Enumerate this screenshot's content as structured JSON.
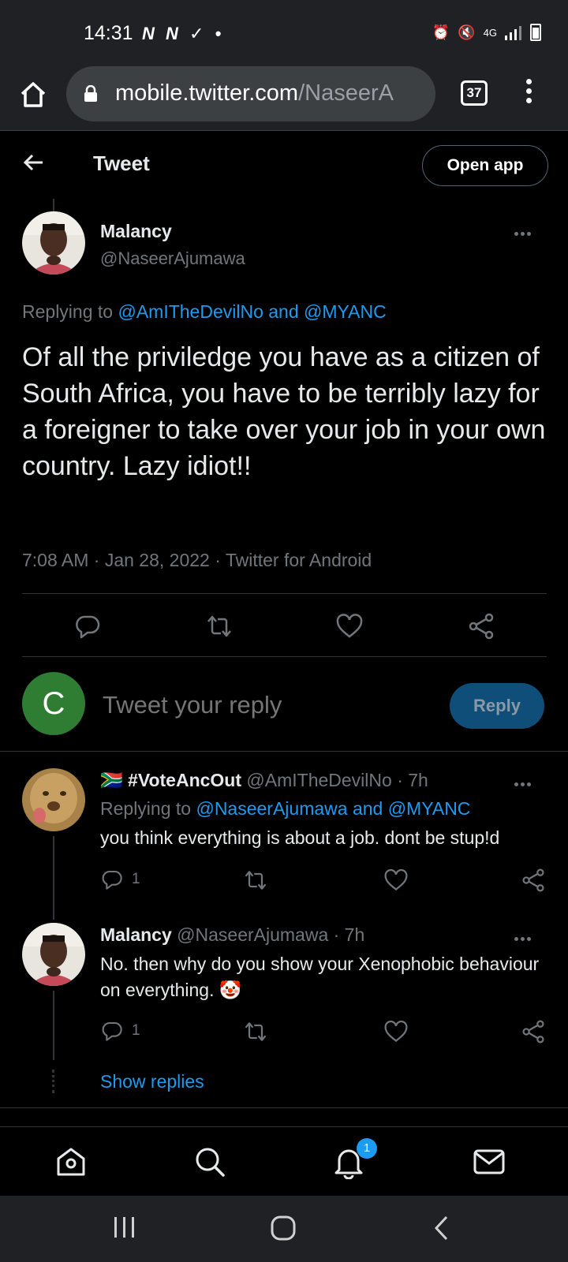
{
  "status_bar": {
    "time": "14:31",
    "left_icons": "N N ✓ •",
    "network": "4G"
  },
  "browser": {
    "url_host": "mobile.twitter.com",
    "url_path": "/NaseerA",
    "tab_count": "37"
  },
  "header": {
    "title": "Tweet",
    "open_app_label": "Open app"
  },
  "main_tweet": {
    "name": "Malancy",
    "handle": "@NaseerAjumawa",
    "replying_prefix": "Replying to ",
    "replying_to": "@AmITheDevilNo and @MYANC",
    "text": "Of all the priviledge you have as a citizen of South Africa, you have to be terribly lazy for a foreigner to take over your job in your own country. Lazy idiot!!",
    "meta": "7:08 AM · Jan 28, 2022 · Twitter for Android"
  },
  "composer": {
    "avatar_letter": "C",
    "placeholder": "Tweet your reply",
    "reply_label": "Reply"
  },
  "replies": [
    {
      "flag": "🇿🇦",
      "name": "#VoteAncOut",
      "handle_time": " @AmITheDevilNo · 7h",
      "replying_prefix": "Replying to ",
      "replying_to": "@NaseerAjumawa and @MYANC",
      "text": "you think everything is about a job. dont be stup!d",
      "reply_count": "1"
    },
    {
      "name": "Malancy",
      "handle_time": " @NaseerAjumawa · 7h",
      "text": "No. then why do you show your Xenophobic behaviour on everything. 🤡",
      "reply_count": "1"
    }
  ],
  "show_replies_label": "Show replies",
  "bottom_nav": {
    "notification_badge": "1"
  }
}
